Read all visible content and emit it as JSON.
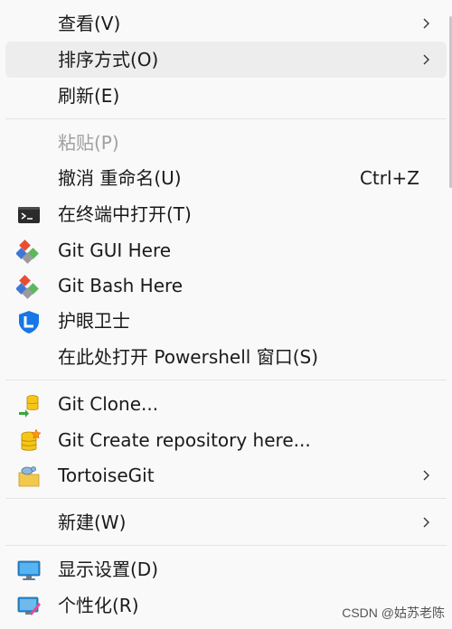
{
  "menu": {
    "items": [
      {
        "label": "查看(V)",
        "has_submenu": true
      },
      {
        "label": "排序方式(O)",
        "has_submenu": true,
        "hovered": true
      },
      {
        "label": "刷新(E)"
      },
      {
        "label": "粘贴(P)",
        "disabled": true
      },
      {
        "label": "撤消 重命名(U)",
        "accelerator": "Ctrl+Z"
      },
      {
        "label": "在终端中打开(T)",
        "icon": "terminal-icon"
      },
      {
        "label": "Git GUI Here",
        "icon": "git-icon"
      },
      {
        "label": "Git Bash Here",
        "icon": "git-icon"
      },
      {
        "label": "护眼卫士",
        "icon": "eye-guard-icon"
      },
      {
        "label": "在此处打开 Powershell 窗口(S)"
      },
      {
        "label": "Git Clone...",
        "icon": "git-clone-icon"
      },
      {
        "label": "Git Create repository here...",
        "icon": "git-create-repo-icon"
      },
      {
        "label": "TortoiseGit",
        "icon": "tortoisegit-icon",
        "has_submenu": true
      },
      {
        "label": "新建(W)",
        "has_submenu": true
      },
      {
        "label": "显示设置(D)",
        "icon": "display-settings-icon"
      },
      {
        "label": "个性化(R)",
        "icon": "personalize-icon"
      }
    ]
  },
  "watermark": "CSDN @姑苏老陈"
}
